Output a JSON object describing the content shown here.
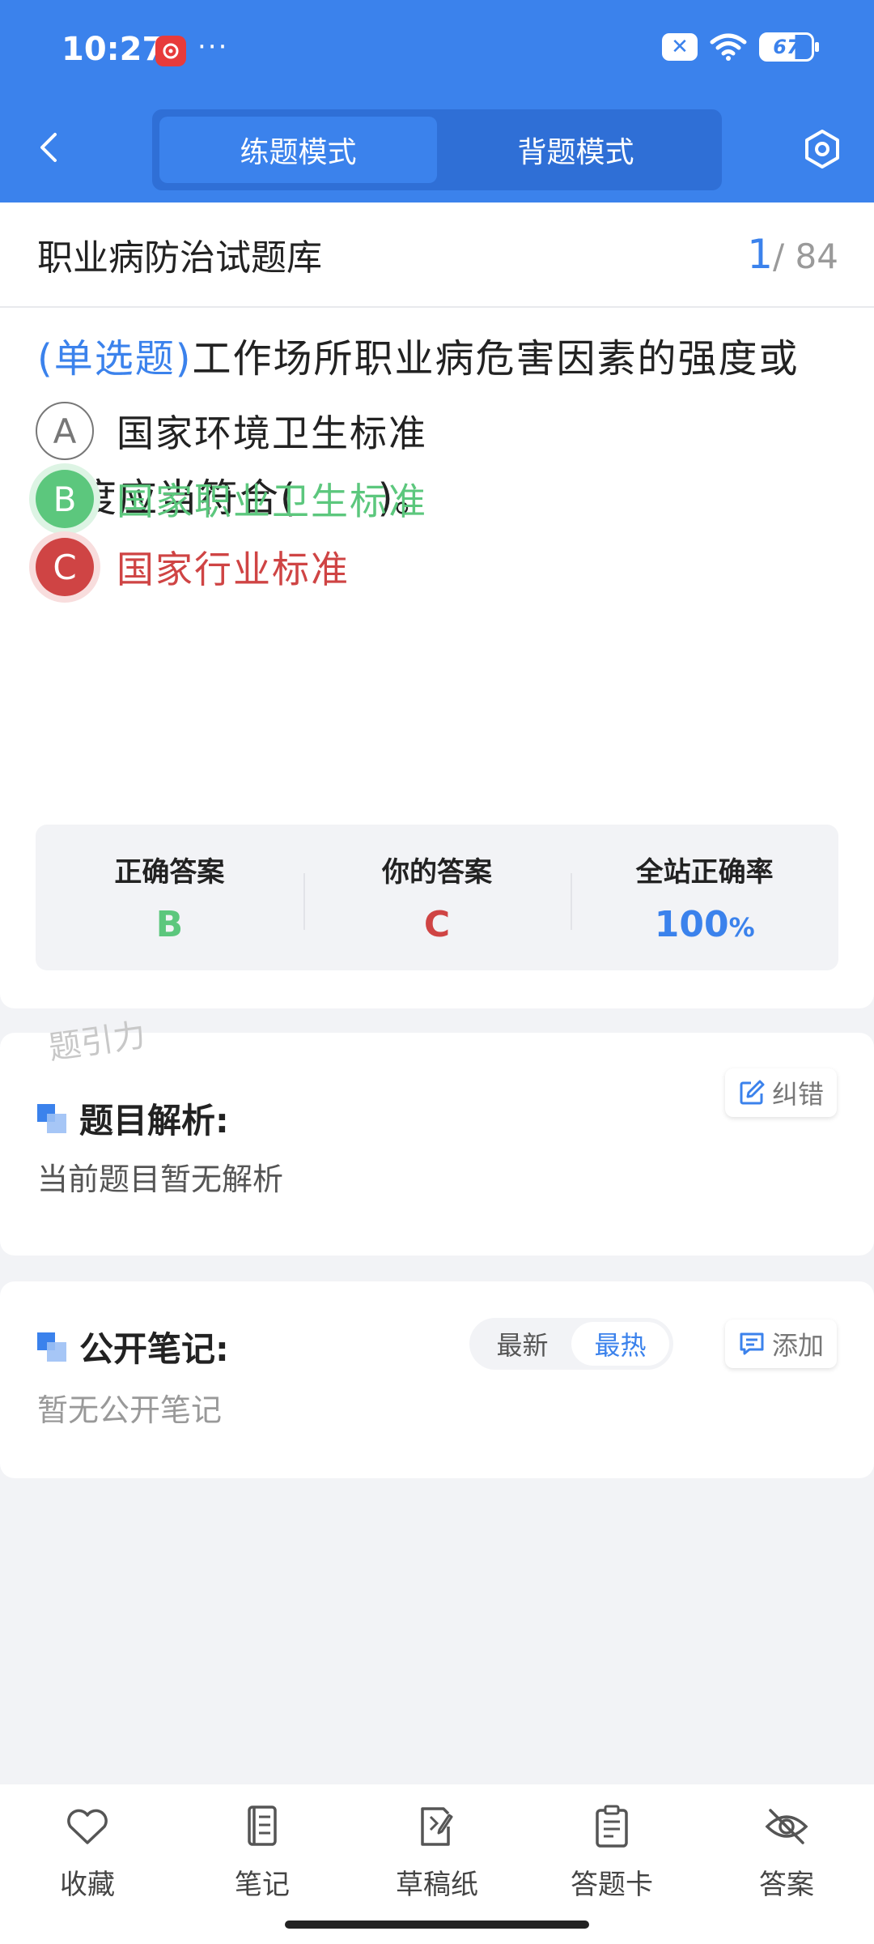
{
  "status_bar": {
    "time": "10:27",
    "more": "···",
    "battery": "67"
  },
  "header": {
    "tabs": [
      {
        "label": "练题模式",
        "active": true
      },
      {
        "label": "背题模式",
        "active": false
      }
    ]
  },
  "question_bank": {
    "title": "职业病防治试题库",
    "current": "1",
    "total": "/ 84"
  },
  "question": {
    "type": "(单选题)",
    "text_line1": "工作场所职业病危害因素的强度或者",
    "text_line2": "浓度应当符合(　　)。",
    "options": [
      {
        "letter": "A",
        "text": "国家环境卫生标准",
        "state": "neutral"
      },
      {
        "letter": "B",
        "text": "国家职业卫生标准",
        "state": "correct"
      },
      {
        "letter": "C",
        "text": "国家行业标准",
        "state": "wrong"
      }
    ]
  },
  "stats": {
    "correct_label": "正确答案",
    "correct_value": "B",
    "yours_label": "你的答案",
    "yours_value": "C",
    "rate_label": "全站正确率",
    "rate_value": "100",
    "rate_unit": "%"
  },
  "watermark": "题引力",
  "analysis": {
    "title": "题目解析:",
    "report_label": "纠错",
    "content": "当前题目暂无解析"
  },
  "notes": {
    "title": "公开笔记:",
    "sort_options": [
      "最新",
      "最热"
    ],
    "sort_active": "最热",
    "add_label": "添加",
    "empty": "暂无公开笔记"
  },
  "bottom_nav": [
    {
      "label": "收藏",
      "icon": "heart-icon"
    },
    {
      "label": "笔记",
      "icon": "notebook-icon"
    },
    {
      "label": "草稿纸",
      "icon": "scratch-paper-icon"
    },
    {
      "label": "答题卡",
      "icon": "answer-card-icon"
    },
    {
      "label": "答案",
      "icon": "eye-off-icon"
    }
  ],
  "colors": {
    "primary": "#3b82ec",
    "correct": "#5cc77d",
    "wrong": "#cf4444"
  }
}
